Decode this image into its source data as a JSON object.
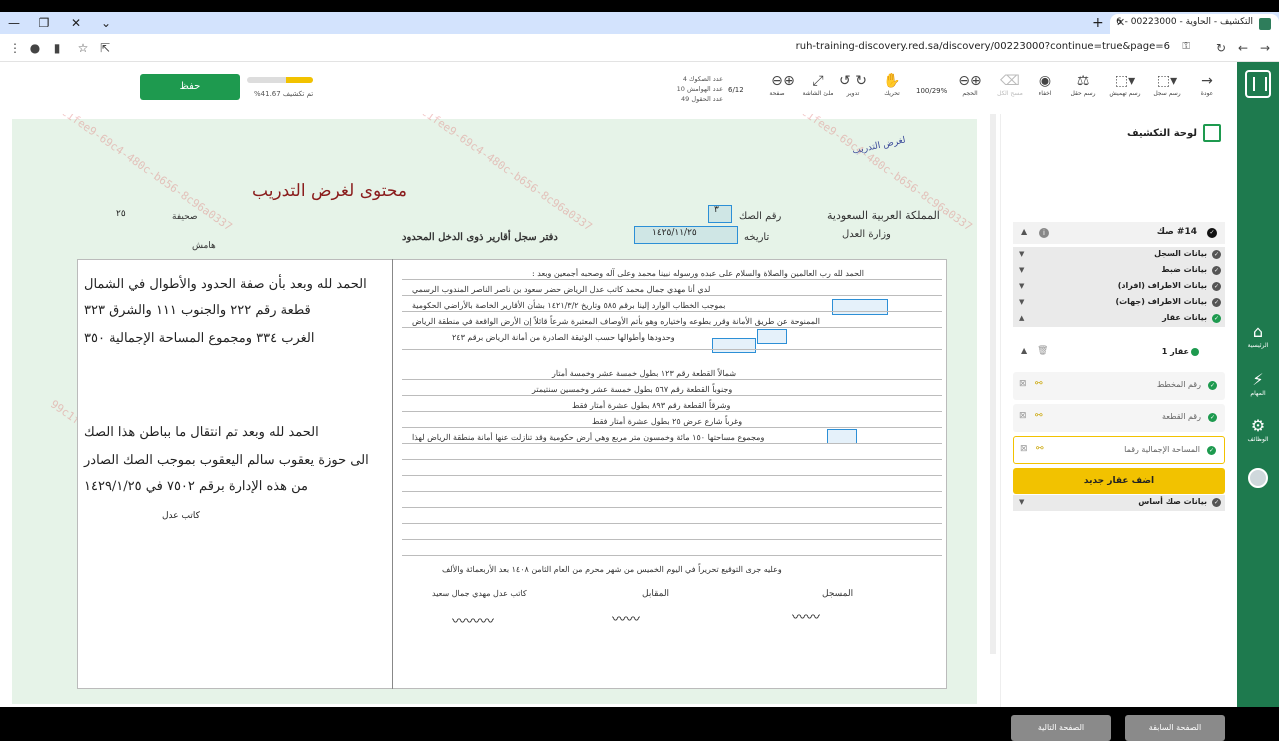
{
  "browser": {
    "tab_title": "التكشيف - الحاوية - 00223000 - 6",
    "url": "ruh-training-discovery.red.sa/discovery/00223000?continue=true&page=6"
  },
  "topbar": {
    "save_label": "حفظ",
    "progress_label": "تم تكشيف 41.67%",
    "progress_percent": 41.67,
    "counts": {
      "docs": "عدد الصكوك 4",
      "margins": "عدد الهوامش 10",
      "fields": "عدد الحقول 49"
    },
    "page_indicator": "6/12",
    "zoom": "100/29%",
    "tools": [
      {
        "label": "عودة",
        "icon": "arrow-right-icon"
      },
      {
        "label": "رسم سجل",
        "icon": "draw-record-icon"
      },
      {
        "label": "رسم تهميش",
        "icon": "draw-margin-icon"
      },
      {
        "label": "رسم حقل",
        "icon": "draw-field-icon"
      },
      {
        "label": "اخفاء",
        "icon": "eye-off-icon"
      },
      {
        "label": "مسح الكل",
        "icon": "eraser-icon"
      },
      {
        "label": "الحجم",
        "icon": "zoom-icon"
      },
      {
        "label": "تحريك",
        "icon": "hand-icon"
      },
      {
        "label": "تدوير",
        "icon": "rotate-icon"
      },
      {
        "label": "ملئ الشاشة",
        "icon": "fullscreen-icon"
      },
      {
        "label": "صفحة",
        "icon": "page-icon"
      }
    ]
  },
  "document": {
    "title": "محتوى لغرض التدريب",
    "header_left_1": "المملكة العربية السعودية",
    "header_left_2": "وزارة العدل",
    "deed_label": "رقم الصك",
    "deed_num": "٣",
    "date_label": "تاريخه",
    "date_val": "١٤٢٥/١١/٢٥",
    "page_label": "صحيفة",
    "page_val": "٢٥",
    "margin_label": "هامش",
    "register": "دفتر سجل أقارير ذوى الدخل المحدود",
    "corner_note": "لغرض التدريب",
    "body_lines": [
      "الحمد لله رب العالمين والصلاة والسلام على عبده ورسوله نبينا محمد وعلى آله وصحبه أجمعين وبعد :",
      "لدي أنا مهدي جمال محمد كاتب عدل الرياض حضر سعود بن ناصر الناصر المندوب الرسمي",
      "بموجب الخطاب الوارد إلينا برقم ٥٨٥ وتاريخ ١٤٢١/٣/٢ بشأن الأقارير الخاصة بالأراضي الحكومية",
      "الممنوحة عن طريق الأمانة وقرر بطوعه واختياره وهو بأتم الأوصاف المعتبرة شرعاً قائلاً إن الأرض الواقعة في منطقة الرياض",
      "وحدودها وأطوالها حسب الوثيقة الصادرة من أمانة الرياض برقم ٢٤٣",
      "شمالاً القطعة رقم ١٢٣ بطول خمسة عشر وخمسة أمتار",
      "وجنوباً القطعة رقم ٥٦٧ بطول خمسة عشر وخمسين سنتيمتر",
      "وشرقاً القطعة رقم ٨٩٣ بطول عشرة أمتار فقط",
      "وغرباً شارع عرض ٢٥ بطول عشرة أمتار فقط",
      "ومجموع مساحتها ١٥٠ مائة وخمسون متر مربع وهي أرض حكومية وقد تنازلت عنها أمانة منطقة الرياض لهذا",
      "وعليه جرى التوقيع تحريراً في اليوم الخميس من شهر محرم من العام الثامن ١٤٠٨ بعد الأربعمائة والألف"
    ],
    "sig_1": "المسجل",
    "sig_2": "المقابل",
    "sig_3": "كاتب عدل مهدي جمال سعيد",
    "hand_left": [
      "الحمد لله وبعد بأن صفة الحدود والأطوال في الشمال",
      "قطعة رقم ٢٢٢ والجنوب ١١١ والشرق ٣٢٣",
      "الغرب ٣٣٤ ومجموع المساحة الإجمالية ٣٥٠",
      "الحمد لله وبعد تم انتقال ما بباطن هذا الصك",
      "الى حوزة يعقوب سالم اليعقوب بموجب الصك الصادر",
      "من هذه الإدارة برقم ٧٥٠٢ في ١٤٢٩/١/٢٥",
      "كاتب عدل"
    ],
    "watermark": "99c1fee9-69c4-480c-b656-8c96a0337"
  },
  "panel": {
    "title": "لوحة التكشيف",
    "deed": "#14 صك",
    "sections": [
      {
        "label": "بيانات السجل",
        "done": false
      },
      {
        "label": "بيانات ضبط",
        "done": false
      },
      {
        "label": "بيانات الاطراف (افراد)",
        "done": false
      },
      {
        "label": "بيانات الاطراف (جهات)",
        "done": false
      },
      {
        "label": "بيانات عقار",
        "done": true
      }
    ],
    "property": "عقار 1",
    "fields": [
      {
        "label": "رقم المخطط"
      },
      {
        "label": "رقم القطعة"
      },
      {
        "label": "المساحة الإجمالية رقما"
      }
    ],
    "add_property": "اضف عقار جديد",
    "base_data": "بيانات صك أساس",
    "prev_page": "الصفحة السابقة",
    "next_page": "الصفحة التالية"
  },
  "rail": {
    "home": "الرئيسية",
    "tasks": "المهام",
    "jobs": "الوظائف"
  },
  "colors": {
    "brand_green": "#1e7a4e",
    "save_green": "#1e9a4f",
    "accent_yellow": "#f2c200",
    "doc_green": "#e6f3e8"
  }
}
